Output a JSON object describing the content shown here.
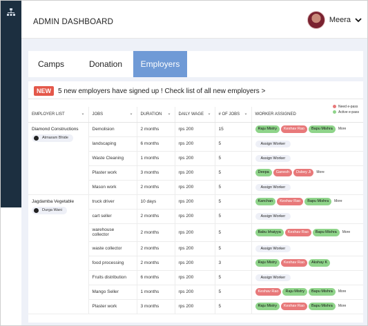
{
  "header": {
    "title": "ADMIN DASHBOARD",
    "user_name": "Meera"
  },
  "tabs": [
    {
      "label": "Camps"
    },
    {
      "label": "Donation"
    },
    {
      "label": "Employers"
    }
  ],
  "notice": {
    "badge": "NEW",
    "text": "5 new employers have signed up !  Check list of all new employers >"
  },
  "legend": {
    "need": "Need e-pass",
    "active": "Active e-pass"
  },
  "colors": {
    "sidebar": "#1c2f40",
    "active_tab": "#6f9ad6",
    "need_epass": "#e8797a",
    "active_epass": "#8fd48a",
    "new_badge": "#e4584a"
  },
  "columns": {
    "employer": "EMPLOYER LIST",
    "jobs": "JOBS",
    "duration": "DURATION",
    "wage": "DAILY WAGE",
    "count": "# OF JOBS",
    "worker": "WORKER ASSIGNED"
  },
  "labels": {
    "assign": "Assign Worker",
    "more": "More"
  },
  "employers": [
    {
      "name": "Diamond Constructions",
      "contact": "Atmaram Bhide"
    },
    {
      "name": "Jagdamba Vegetable",
      "contact": "Durga Wani"
    }
  ],
  "rows": [
    {
      "job": "Demolision",
      "duration": "2 months",
      "wage": "rps 200",
      "count": "15",
      "workers": [
        {
          "n": "Raju Mistry",
          "s": "active"
        },
        {
          "n": "Keshav Rao",
          "s": "need"
        },
        {
          "n": "Bapu Mishra",
          "s": "active"
        }
      ],
      "more": true
    },
    {
      "job": "landscaping",
      "duration": "6 months",
      "wage": "rps 200",
      "count": "5",
      "workers": [],
      "more": false
    },
    {
      "job": "Waste Cleaning",
      "duration": "1 months",
      "wage": "rps 200",
      "count": "5",
      "workers": [],
      "more": false
    },
    {
      "job": "Plaster work",
      "duration": "3 months",
      "wage": "rps 200",
      "count": "5",
      "workers": [
        {
          "n": "Deepa",
          "s": "active"
        },
        {
          "n": "Ganesh",
          "s": "need"
        },
        {
          "n": "Dubey Ji",
          "s": "need"
        }
      ],
      "more": true
    },
    {
      "job": "Mason work",
      "duration": "2 months",
      "wage": "rps 200",
      "count": "5",
      "workers": [],
      "more": false
    },
    {
      "job": "truck driver",
      "duration": "10 days",
      "wage": "rps 200",
      "count": "5",
      "workers": [
        {
          "n": "Kanchan",
          "s": "active"
        },
        {
          "n": "Keshav Rao",
          "s": "need"
        },
        {
          "n": "Bapu Mishra",
          "s": "active"
        }
      ],
      "more": true
    },
    {
      "job": "cart seller",
      "duration": "2 months",
      "wage": "rps 200",
      "count": "5",
      "workers": [],
      "more": false
    },
    {
      "job": "warehouse\ncollector",
      "duration": "2 months",
      "wage": "rps 200",
      "count": "5",
      "workers": [
        {
          "n": "Babu bhaiyya",
          "s": "active"
        },
        {
          "n": "Keshav Rao",
          "s": "need"
        },
        {
          "n": "Bapu Mishra",
          "s": "active"
        }
      ],
      "more": true
    },
    {
      "job": "waste collector",
      "duration": "2 months",
      "wage": "rps 200",
      "count": "5",
      "workers": [],
      "more": false
    },
    {
      "job": "food processing",
      "duration": "2 months",
      "wage": "rps 200",
      "count": "3",
      "workers": [
        {
          "n": "Raju Mistry",
          "s": "active"
        },
        {
          "n": "Keshav Rao",
          "s": "need"
        },
        {
          "n": "Akshay K",
          "s": "active"
        }
      ],
      "more": false
    },
    {
      "job": "Fruits distribution",
      "duration": "6 months",
      "wage": "rps 200",
      "count": "5",
      "workers": [],
      "more": false
    },
    {
      "job": "Mango Seller",
      "duration": "1 months",
      "wage": "rps 200",
      "count": "5",
      "workers": [
        {
          "n": "Keshav Rao",
          "s": "need"
        },
        {
          "n": "Raju Mistry",
          "s": "active"
        },
        {
          "n": "Bapu Mishra",
          "s": "active"
        }
      ],
      "more": true
    },
    {
      "job": "Plaster work",
      "duration": "3 months",
      "wage": "rps 200",
      "count": "5",
      "workers": [
        {
          "n": "Raju Mistry",
          "s": "active"
        },
        {
          "n": "Keshav Rao",
          "s": "need"
        },
        {
          "n": "Bapu Mishra",
          "s": "active"
        }
      ],
      "more": true
    }
  ]
}
